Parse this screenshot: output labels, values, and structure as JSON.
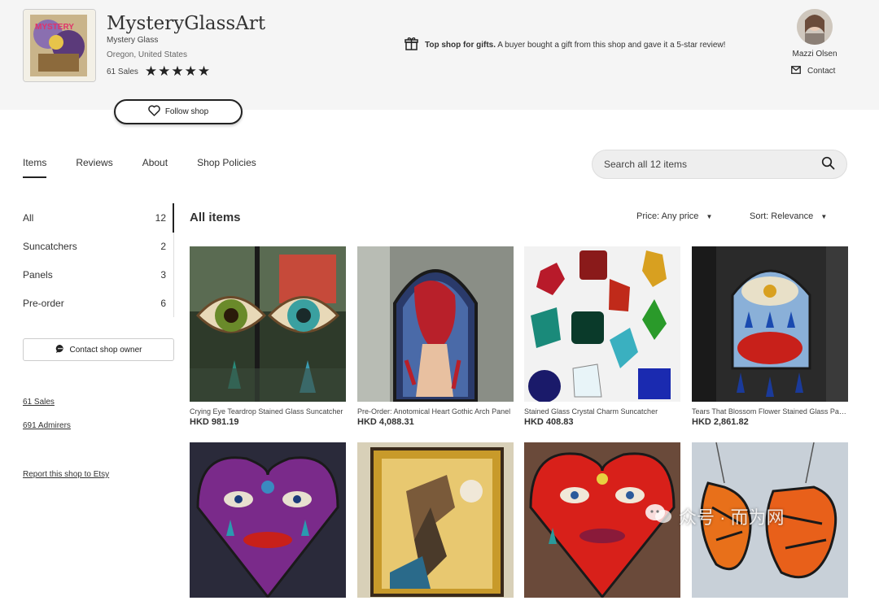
{
  "shop": {
    "name": "MysteryGlassArt",
    "subtitle": "Mystery Glass",
    "location": "Oregon, United States",
    "sales": "61 Sales",
    "stars": "★★★★★",
    "follow_label": "Follow shop"
  },
  "banner": {
    "bold": "Top shop for gifts.",
    "text": "A buyer bought a gift from this shop and gave it a 5-star review!"
  },
  "owner": {
    "name": "Mazzi Olsen",
    "contact_label": "Contact"
  },
  "nav": {
    "items": [
      "Items",
      "Reviews",
      "About",
      "Shop Policies"
    ]
  },
  "search": {
    "placeholder": "Search all 12 items"
  },
  "sidebar": {
    "categories": [
      {
        "label": "All",
        "count": "12"
      },
      {
        "label": "Suncatchers",
        "count": "2"
      },
      {
        "label": "Panels",
        "count": "3"
      },
      {
        "label": "Pre-order",
        "count": "6"
      }
    ],
    "contact_owner_label": "Contact shop owner",
    "sales_link": "61 Sales",
    "admirers_link": "691 Admirers",
    "report_link": "Report this shop to Etsy"
  },
  "main": {
    "heading": "All items",
    "price_filter": "Price: Any price",
    "sort": "Sort: Relevance"
  },
  "products": [
    {
      "title": "Crying Eye Teardrop Stained Glass Suncatcher",
      "price": "HKD 981.19"
    },
    {
      "title": "Pre-Order: Anotomical Heart Gothic Arch Panel",
      "price": "HKD 4,088.31"
    },
    {
      "title": "Stained Glass Crystal Charm Suncatcher",
      "price": "HKD 408.83"
    },
    {
      "title": "Tears That Blossom Flower Stained Glass Panel",
      "price": "HKD 2,861.82"
    },
    {
      "title": "",
      "price": ""
    },
    {
      "title": "",
      "price": ""
    },
    {
      "title": "",
      "price": ""
    },
    {
      "title": "",
      "price": ""
    }
  ],
  "watermark": "众号 · 而为网",
  "colors": {
    "accent": "#222222",
    "band": "#f5f5f5",
    "search_bg": "#eeeeee"
  }
}
